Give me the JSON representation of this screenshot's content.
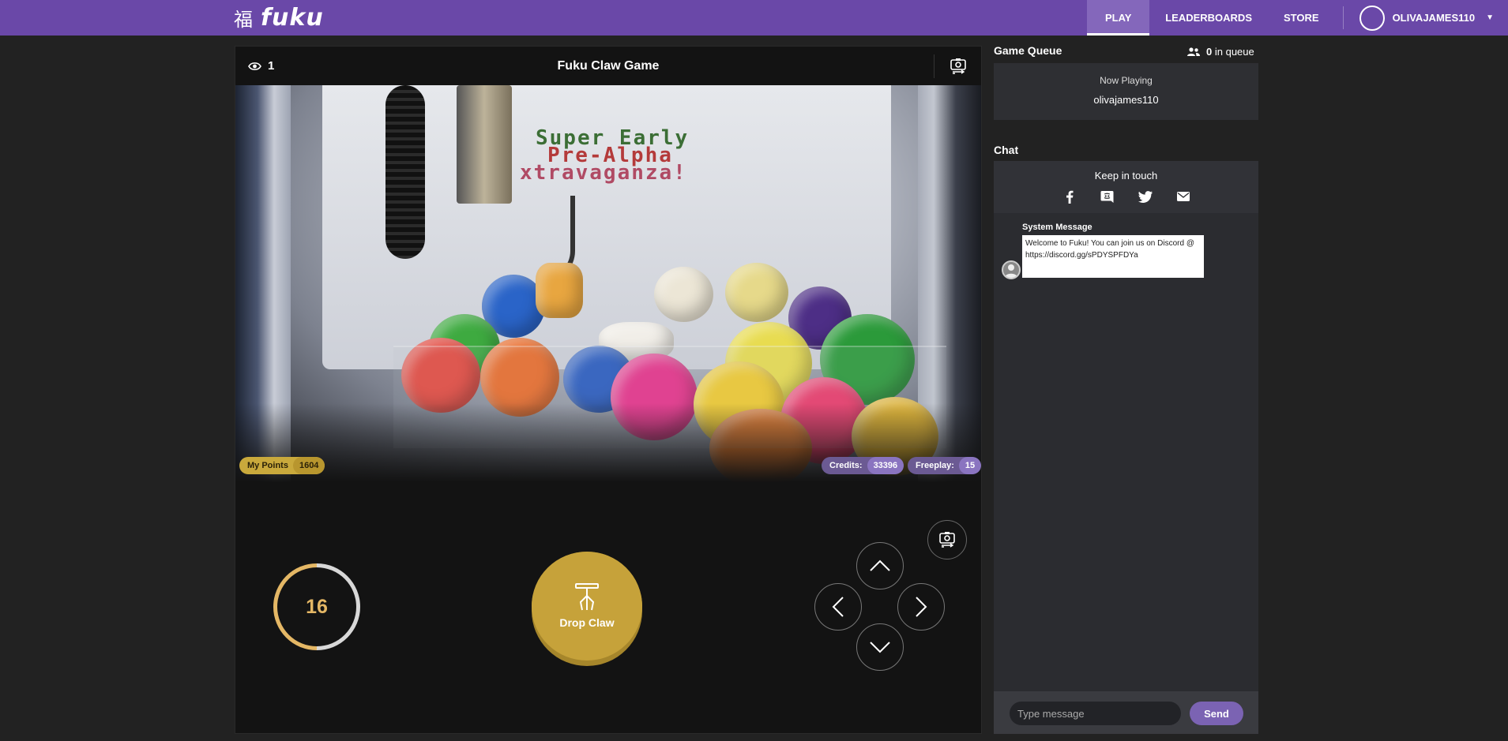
{
  "nav": {
    "logo_kanji": "福",
    "logo_text": "fuku",
    "items": [
      {
        "label": "PLAY",
        "active": true
      },
      {
        "label": "LEADERBOARDS",
        "active": false
      },
      {
        "label": "STORE",
        "active": false
      }
    ],
    "username": "OLIVAJAMES110"
  },
  "game": {
    "viewer_count": "1",
    "title": "Fuku Claw Game",
    "video_text": [
      "Super Early",
      "Pre-Alpha",
      "xtravaganza!"
    ],
    "points": {
      "label": "My Points",
      "value": "1604"
    },
    "credits": {
      "label": "Credits:",
      "value": "33396"
    },
    "freeplay": {
      "label": "Freeplay:",
      "value": "15"
    },
    "timer": "16",
    "timer_progress": 0.5,
    "drop_label": "Drop Claw"
  },
  "queue": {
    "title": "Game Queue",
    "count": "0",
    "count_suffix": "in queue",
    "now_playing_label": "Now Playing",
    "now_playing_user": "olivajames110"
  },
  "chat": {
    "title": "Chat",
    "keep_in_touch": "Keep in touch",
    "socials": [
      "facebook-icon",
      "discord-icon",
      "twitter-icon",
      "email-icon"
    ],
    "messages": [
      {
        "author": "System Message",
        "text": "Welcome to Fuku! You can join us on Discord @ https://discord.gg/sPDYSPFDYa"
      }
    ],
    "input_placeholder": "Type message",
    "send_label": "Send"
  },
  "colors": {
    "brand": "#6a48a8",
    "gold": "#c6a23a",
    "accent": "#8a74c0"
  }
}
